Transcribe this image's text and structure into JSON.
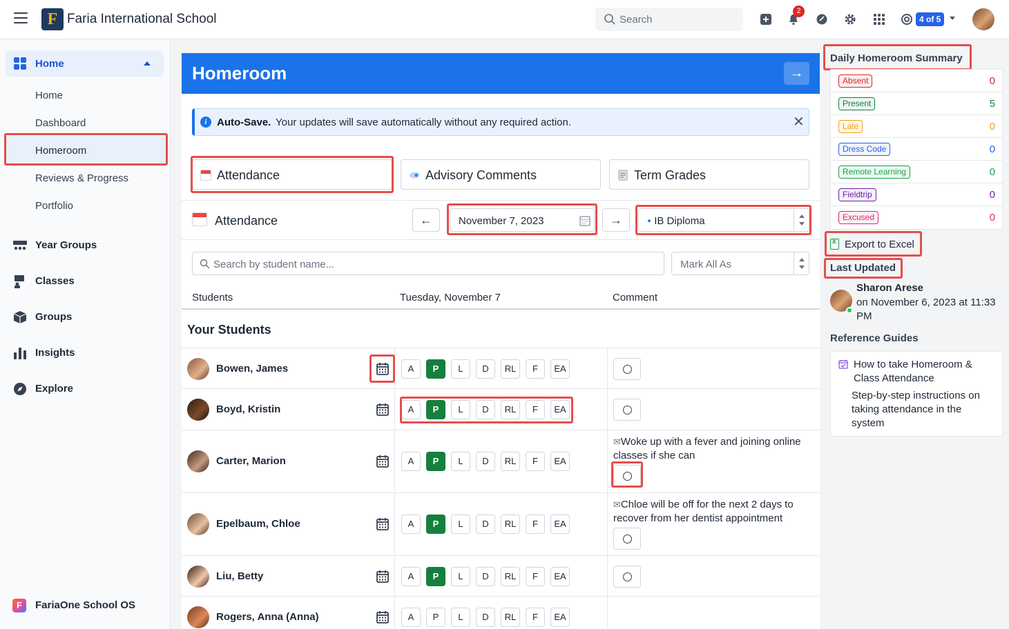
{
  "topbar": {
    "school_name": "Faria International School",
    "logo_letter": "F",
    "search_placeholder": "Search",
    "notification_count": "2",
    "guide_progress": "4 of 5"
  },
  "sidebar": {
    "home_group_label": "Home",
    "home_items": [
      {
        "label": "Home"
      },
      {
        "label": "Dashboard"
      },
      {
        "label": "Homeroom"
      },
      {
        "label": "Reviews & Progress"
      },
      {
        "label": "Portfolio"
      }
    ],
    "nav": [
      {
        "label": "Year Groups",
        "icon": "year-groups-icon"
      },
      {
        "label": "Classes",
        "icon": "classes-icon"
      },
      {
        "label": "Groups",
        "icon": "groups-icon"
      },
      {
        "label": "Insights",
        "icon": "insights-icon"
      },
      {
        "label": "Explore",
        "icon": "compass-icon"
      }
    ],
    "footer_label": "FariaOne School OS"
  },
  "main": {
    "title": "Homeroom",
    "autosave_title": "Auto-Save.",
    "autosave_text": "Your updates will save automatically without any required action.",
    "tabs": [
      {
        "label": "Attendance"
      },
      {
        "label": "Advisory Comments"
      },
      {
        "label": "Term Grades"
      }
    ],
    "attendance_label": "Attendance",
    "date_value": "November 7, 2023",
    "program_value": "IB Diploma",
    "search_placeholder": "Search by student name...",
    "mark_all_placeholder": "Mark All As",
    "col_students": "Students",
    "col_day": "Tuesday, November 7",
    "col_comment": "Comment",
    "section_title": "Your Students",
    "attendance_codes": [
      "A",
      "P",
      "L",
      "D",
      "RL",
      "F",
      "EA"
    ],
    "students": [
      {
        "name": "Bowen, James",
        "selected": "P",
        "comment": ""
      },
      {
        "name": "Boyd, Kristin",
        "selected": "P",
        "comment": ""
      },
      {
        "name": "Carter, Marion",
        "selected": "P",
        "comment": "Woke up with a fever and joining online classes if she can"
      },
      {
        "name": "Epelbaum, Chloe",
        "selected": "P",
        "comment": "Chloe will be off for the next 2 days to recover from her dentist appointment"
      },
      {
        "name": "Liu, Betty",
        "selected": "P",
        "comment": ""
      },
      {
        "name": "Rogers, Anna (Anna)",
        "selected": "",
        "comment": ""
      }
    ]
  },
  "right": {
    "summary_title": "Daily Homeroom Summary",
    "summary": [
      {
        "label": "Absent",
        "count": "0",
        "color": "#dc2626"
      },
      {
        "label": "Present",
        "count": "5",
        "color": "#15803d"
      },
      {
        "label": "Late",
        "count": "0",
        "color": "#f59e0b"
      },
      {
        "label": "Dress Code",
        "count": "0",
        "color": "#2563eb"
      },
      {
        "label": "Remote Learning",
        "count": "0",
        "color": "#16a34a"
      },
      {
        "label": "Fieldtrip",
        "count": "0",
        "color": "#6b21a8"
      },
      {
        "label": "Excused",
        "count": "0",
        "color": "#db2777"
      }
    ],
    "export_label": "Export to Excel",
    "last_updated_title": "Last Updated",
    "last_updated_by": "Sharon Arese",
    "last_updated_when": "on November 6, 2023 at 11:33 PM",
    "reference_title": "Reference Guides",
    "guide_title": "How to take Homeroom & Class Attendance",
    "guide_desc": "Step-by-step instructions on taking attendance in the system"
  }
}
